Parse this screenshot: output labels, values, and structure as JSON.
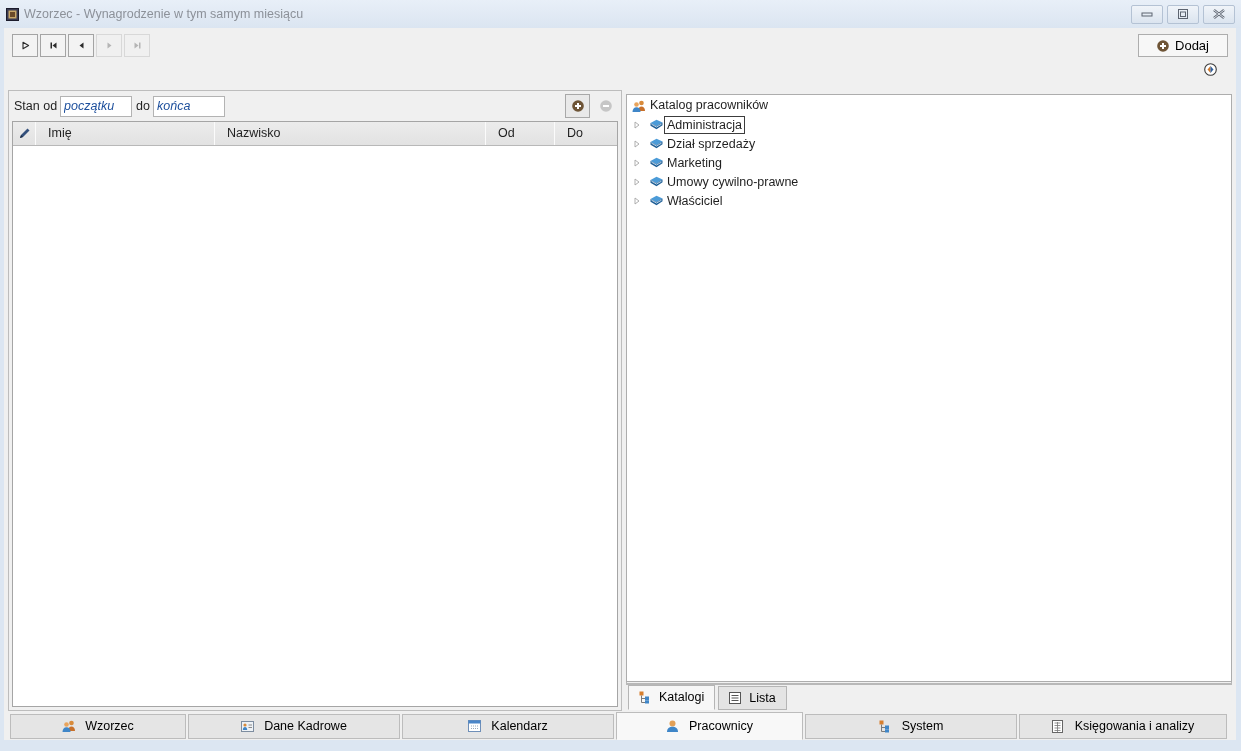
{
  "window": {
    "title": "Wzorzec - Wynagrodzenie w tym samym miesiącu"
  },
  "toolbar": {
    "nav_buttons": [
      {
        "kind": "play",
        "disabled": false
      },
      {
        "kind": "first",
        "disabled": false
      },
      {
        "kind": "previous",
        "disabled": false
      },
      {
        "kind": "next",
        "disabled": true
      },
      {
        "kind": "last",
        "disabled": true
      }
    ],
    "add_button": {
      "label": "Dodaj"
    }
  },
  "filter": {
    "from_label": "Stan od",
    "from_value": "początku",
    "to_label": "do",
    "to_value": "końca",
    "buttons": [
      {
        "kind": "add",
        "disabled": false
      },
      {
        "kind": "remove",
        "disabled": true
      }
    ]
  },
  "grid": {
    "columns": [
      {
        "kind": "edit"
      },
      {
        "kind": "text",
        "label": "Imię"
      },
      {
        "kind": "text",
        "label": "Nazwisko"
      },
      {
        "kind": "text",
        "label": "Od"
      },
      {
        "kind": "text",
        "label": "Do"
      }
    ]
  },
  "tree": {
    "root": {
      "label": "Katalog pracowników",
      "children": [
        {
          "label": "Administracja",
          "selected": true,
          "expanded": false
        },
        {
          "label": "Dział sprzedaży",
          "selected": false,
          "expanded": false
        },
        {
          "label": "Marketing",
          "selected": false,
          "expanded": false
        },
        {
          "label": "Umowy cywilno-prawne",
          "selected": false,
          "expanded": false
        },
        {
          "label": "Właściciel",
          "selected": false,
          "expanded": false
        }
      ]
    }
  },
  "panel_tabs": [
    {
      "label": "Katalogi",
      "kind": "catalogs",
      "selected": true
    },
    {
      "label": "Lista",
      "kind": "list",
      "selected": false
    }
  ],
  "bottom_tabs": [
    {
      "label": "Wzorzec",
      "kind": "template",
      "selected": false
    },
    {
      "label": "Dane Kadrowe",
      "kind": "records",
      "selected": false
    },
    {
      "label": "Kalendarz",
      "kind": "calendar",
      "selected": false
    },
    {
      "label": "Pracownicy",
      "kind": "employees",
      "selected": true
    },
    {
      "label": "System",
      "kind": "system",
      "selected": false
    },
    {
      "label": "Księgowania i analizy",
      "kind": "accounting",
      "selected": false
    }
  ]
}
